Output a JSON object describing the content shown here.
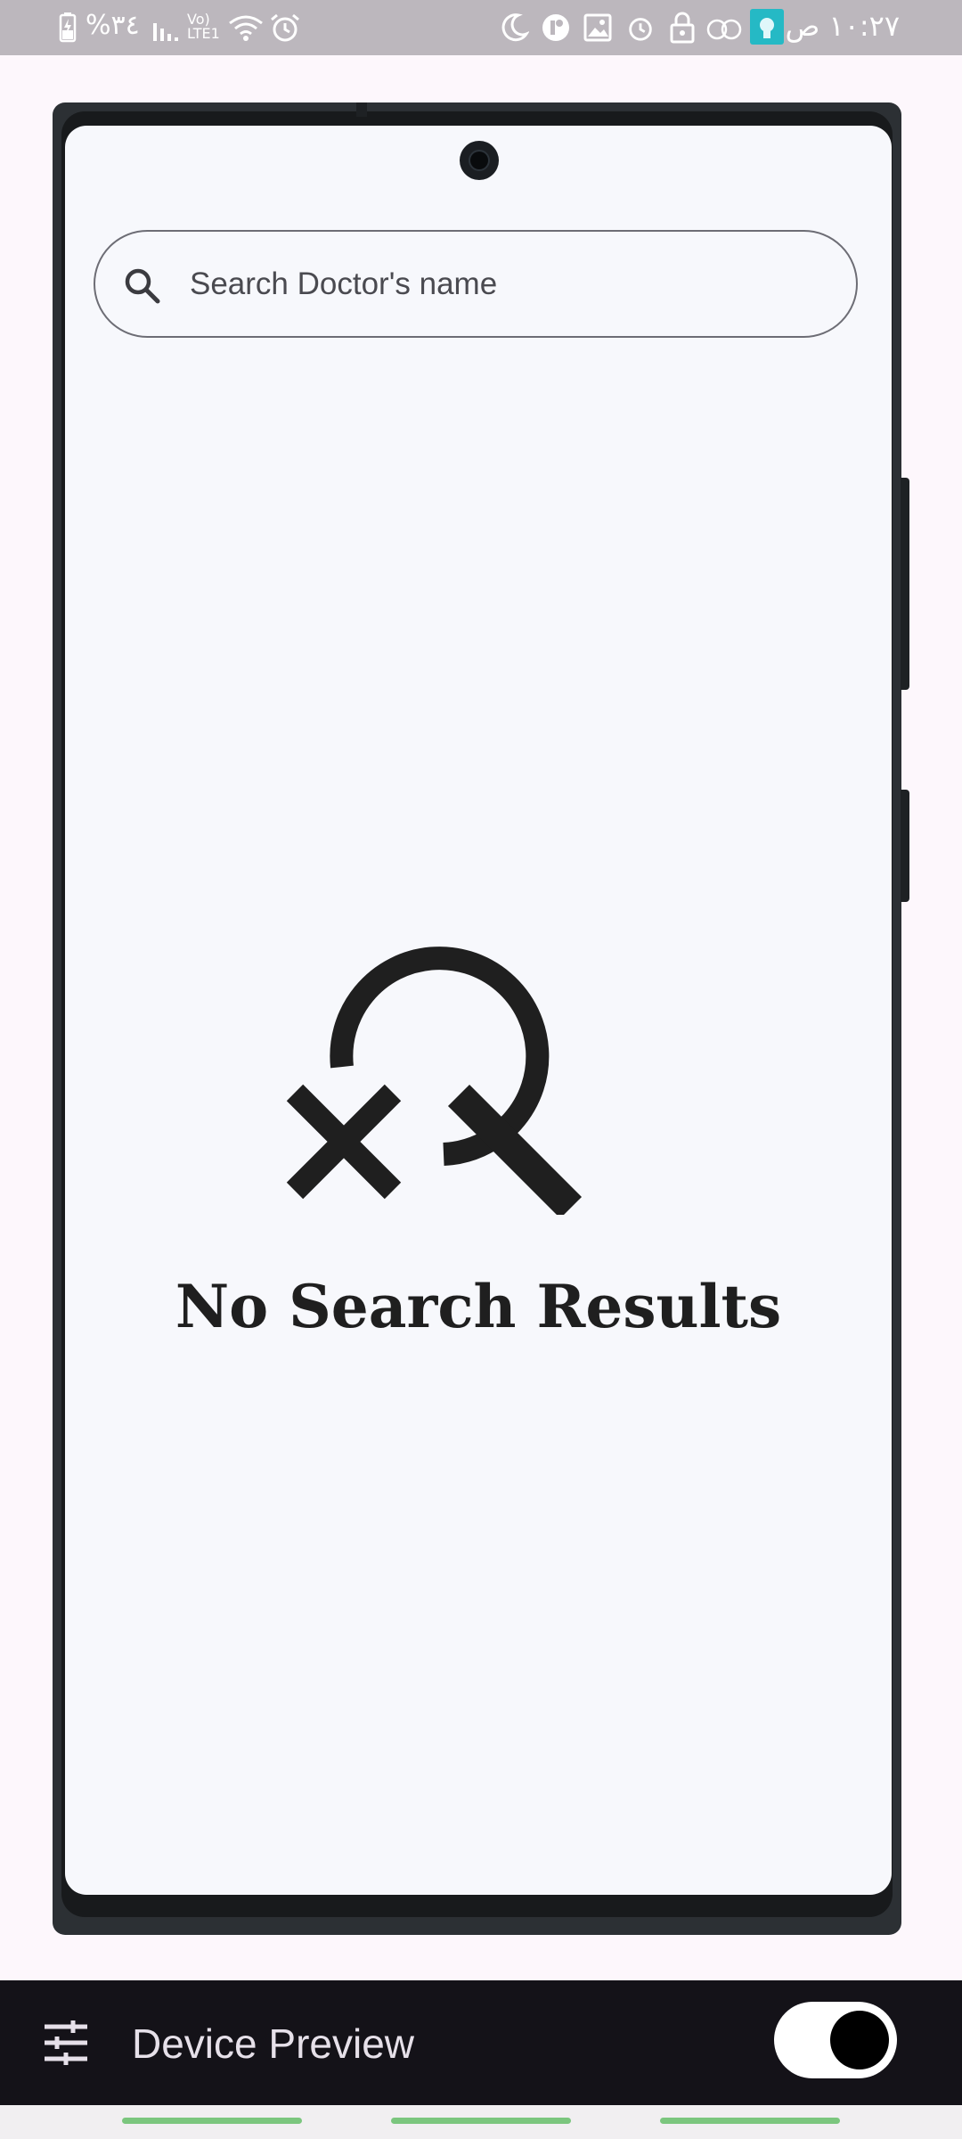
{
  "status_bar": {
    "time": "١٠:٢٧ ص",
    "battery": "%٣٤",
    "network": "Vo) LTE1",
    "icons": [
      "battery-icon",
      "signal-icon",
      "wifi-icon",
      "alarm-icon",
      "moon-icon",
      "app-icon",
      "image-icon",
      "alarm-icon",
      "lock-icon",
      "data-saver-icon",
      "app-badge-icon"
    ]
  },
  "screen": {
    "search": {
      "placeholder": "Search Doctor's name",
      "value": "",
      "icon": "search-icon"
    },
    "empty_state": {
      "icon": "search-off-icon",
      "title": "No Search Results"
    }
  },
  "device_preview": {
    "title": "Device Preview",
    "settings_icon": "tune-icon",
    "toggle_on": true
  },
  "colors": {
    "status_bar": "#bcb7bd",
    "screen_bg": "#f7f8fc",
    "toolbar_bg": "#141218",
    "nav_pill": "#7bc67e"
  }
}
